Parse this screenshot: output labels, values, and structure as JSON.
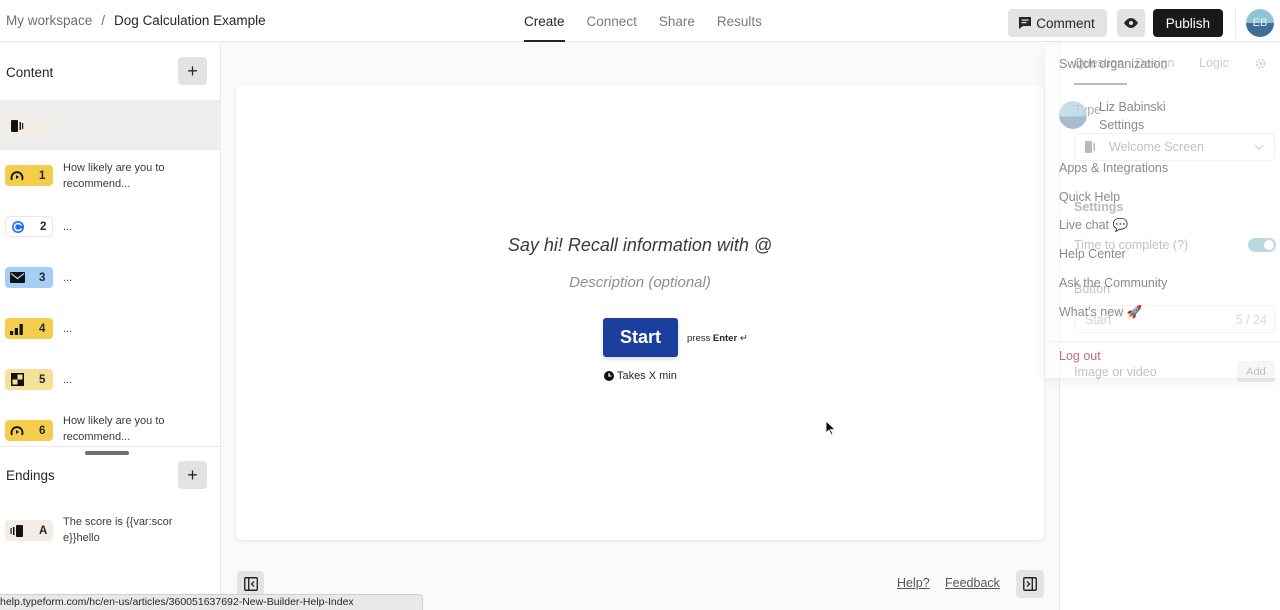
{
  "topbar": {
    "breadcrumb_workspace": "My workspace",
    "breadcrumb_separator": "/",
    "form_title": "Dog Calculation Example",
    "tabs": [
      {
        "label": "Create",
        "active": true
      },
      {
        "label": "Connect",
        "active": false
      },
      {
        "label": "Share",
        "active": false
      },
      {
        "label": "Results",
        "active": false
      }
    ],
    "comment_label": "Comment",
    "preview_icon": "eye-icon",
    "publish_label": "Publish",
    "avatar_initials": "EB"
  },
  "content_panel": {
    "title": "Content",
    "add_label": "+",
    "items": [
      {
        "icon": "welcome-screen-icon",
        "number": "",
        "text": "",
        "color": "#f3ede6",
        "selected": true
      },
      {
        "icon": "nps-gauge-icon",
        "number": "1",
        "text": "How likely are you to recommend...",
        "color": "#f5cd4c"
      },
      {
        "icon": "contact-info-icon",
        "number": "2",
        "text": "...",
        "color": "#ffffff"
      },
      {
        "icon": "email-icon",
        "number": "3",
        "text": "...",
        "color": "#a5cdf5"
      },
      {
        "icon": "rating-bars-icon",
        "number": "4",
        "text": "...",
        "color": "#f5cd4c"
      },
      {
        "icon": "matrix-icon",
        "number": "5",
        "text": "...",
        "color": "#f6e199"
      },
      {
        "icon": "nps-gauge-icon",
        "number": "6",
        "text": "How likely are you to recommend...",
        "color": "#f5cd4c"
      }
    ]
  },
  "endings_panel": {
    "title": "Endings",
    "add_label": "+",
    "items": [
      {
        "icon": "ending-screen-icon",
        "letter": "A",
        "text": "The score is {{var:score}}hello",
        "color": "#f3ede6"
      }
    ]
  },
  "canvas": {
    "title": "Say hi! Recall information with @",
    "description_placeholder": "Description (optional)",
    "start_label": "Start",
    "press_label": "press",
    "enter_label": "Enter",
    "enter_glyph": "↵",
    "time_label": "Takes X min"
  },
  "footer": {
    "help_link": "Help?",
    "feedback_link": "Feedback",
    "status_url": "help.typeform.com/hc/en-us/articles/360051637692-New-Builder-Help-Index"
  },
  "settings_panel": {
    "tabs": [
      "Question",
      "Design",
      "Logic"
    ],
    "type_label": "Type",
    "type_value": "Welcome Screen",
    "settings_heading": "Settings",
    "time_to_complete_label": "Time to complete (?)",
    "time_to_complete_enabled": true,
    "button_label": "Button",
    "button_text_value": "Start",
    "button_text_count": "5 / 24",
    "media_label": "Image or video",
    "media_add_label": "Add"
  },
  "user_menu": {
    "switch_org": "Switch organization",
    "user_name": "Liz Babinski",
    "user_settings": "Settings",
    "apps": "Apps & Integrations",
    "quick_help": "Quick Help",
    "live_chat": "Live chat 💬",
    "help_center": "Help Center",
    "community": "Ask the Community",
    "whats_new": "What's new 🚀",
    "logout": "Log out",
    "logout_color": "#c26a7a"
  }
}
